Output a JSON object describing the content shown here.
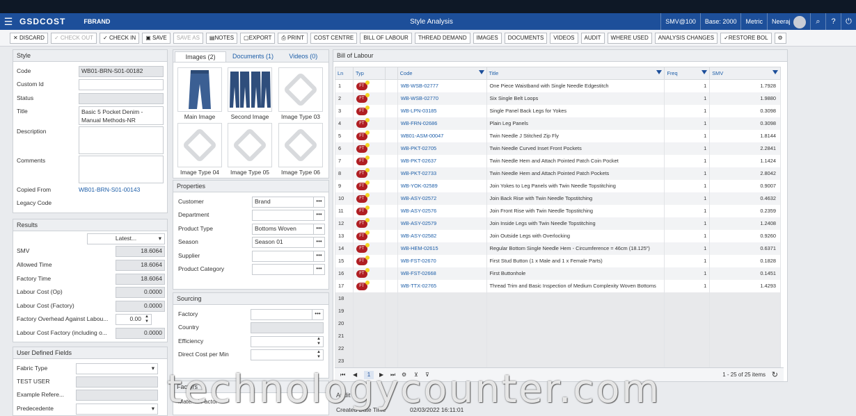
{
  "app": {
    "logo": "GSDCOST",
    "brand": "FBRAND",
    "title": "Style Analysis",
    "smv_mode": "SMV@100",
    "base": "Base: 2000",
    "units": "Metric",
    "user": "Neeraj"
  },
  "toolbar": [
    "DISCARD",
    "CHECK OUT",
    "CHECK IN",
    "SAVE",
    "SAVE AS",
    "NOTES",
    "EXPORT",
    "PRINT",
    "COST CENTRE",
    "BILL OF LABOUR",
    "THREAD DEMAND",
    "IMAGES",
    "DOCUMENTS",
    "VIDEOS",
    "AUDIT",
    "WHERE USED",
    "ANALYSIS CHANGES",
    "RESTORE BOL"
  ],
  "style": {
    "header": "Style",
    "fields": [
      {
        "label": "Code",
        "value": "WB01-BRN-S01-00182"
      },
      {
        "label": "Custom Id",
        "value": ""
      },
      {
        "label": "Status",
        "value": ""
      },
      {
        "label": "Title",
        "value": "Basic 5 Pocket Denim - Manual Methods-NR"
      },
      {
        "label": "Description",
        "value": ""
      },
      {
        "label": "Comments",
        "value": ""
      },
      {
        "label": "Copied From",
        "value": "WB01-BRN-S01-00143"
      },
      {
        "label": "Legacy Code",
        "value": ""
      }
    ]
  },
  "results": {
    "header": "Results",
    "selector": "Latest...",
    "fields": [
      {
        "label": "SMV",
        "value": "18.6064"
      },
      {
        "label": "Allowed Time",
        "value": "18.6064"
      },
      {
        "label": "Factory Time",
        "value": "18.6064"
      },
      {
        "label": "Labour Cost (Op)",
        "value": "0.0000"
      },
      {
        "label": "Labour Cost (Factory)",
        "value": "0.0000"
      },
      {
        "label": "Factory Overhead Against Labou...",
        "value": "0.00"
      },
      {
        "label": "Labour Cost Factory (including o...",
        "value": "0.0000"
      }
    ]
  },
  "udf": {
    "header": "User Defined Fields",
    "fields": [
      "Fabric Type",
      "TEST USER",
      "Example Refere...",
      "Predecedente"
    ]
  },
  "media": {
    "tabs": [
      "Images (2)",
      "Documents (1)",
      "Videos (0)"
    ],
    "images": [
      "Main Image",
      "Second Image",
      "Image Type 03",
      "Image Type 04",
      "Image Type 05",
      "Image Type 06"
    ]
  },
  "properties": {
    "header": "Properties",
    "fields": [
      {
        "label": "Customer",
        "value": "Brand"
      },
      {
        "label": "Department",
        "value": ""
      },
      {
        "label": "Product Type",
        "value": "Bottoms Woven"
      },
      {
        "label": "Season",
        "value": "Season 01"
      },
      {
        "label": "Supplier",
        "value": ""
      },
      {
        "label": "Product Category",
        "value": ""
      }
    ]
  },
  "sourcing": {
    "header": "Sourcing",
    "fields": [
      "Factory",
      "Country",
      "Efficiency",
      "Direct Cost per Min"
    ]
  },
  "factors": {
    "header": "Factors",
    "sub": "Material Factor"
  },
  "audit": {
    "header": "Audit",
    "created_label": "Created Date Time",
    "created": "02/03/2022 16:11:01"
  },
  "bol": {
    "header": "Bill of Labour",
    "columns": [
      "Ln",
      "Typ",
      "Code",
      "Title",
      "Freq",
      "SMV"
    ],
    "type_badge": "FT",
    "rows": [
      [
        "1",
        "WB-WSB-02777",
        "One Piece Waistband with Single Needle Edgestitch",
        "1",
        "1.7928"
      ],
      [
        "2",
        "WB-WSB-02770",
        "Six Single Belt Loops",
        "1",
        "1.9880"
      ],
      [
        "3",
        "WB-LPN-03185",
        "Single Panel Back Legs for Yokes",
        "1",
        "0.3098"
      ],
      [
        "4",
        "WB-FRN-02686",
        "Plain Leg Panels",
        "1",
        "0.3098"
      ],
      [
        "5",
        "WB01-ASM-00047",
        "Twin Needle J Stitched Zip Fly",
        "1",
        "1.8144"
      ],
      [
        "6",
        "WB-PKT-02705",
        "Twin Needle Curved Inset Front Pockets",
        "1",
        "2.2841"
      ],
      [
        "7",
        "WB-PKT-02637",
        "Twin Needle Hem and Attach Pointed Patch Coin Pocket",
        "1",
        "1.1424"
      ],
      [
        "8",
        "WB-PKT-02733",
        "Twin Needle Hem and Attach Pointed Patch Pockets",
        "1",
        "2.8042"
      ],
      [
        "9",
        "WB-YOK-02589",
        "Join Yokes to Leg Panels with Twin Needle Topstitching",
        "1",
        "0.9007"
      ],
      [
        "10",
        "WB-ASY-02572",
        "Join Back Rise with Twin Needle Topstitching",
        "1",
        "0.4632"
      ],
      [
        "11",
        "WB-ASY-02576",
        "Join Front Rise with Twin Needle Topstitching",
        "1",
        "0.2359"
      ],
      [
        "12",
        "WB-ASY-02579",
        "Join Inside Legs with Twin Needle Topstitching",
        "1",
        "1.2408"
      ],
      [
        "13",
        "WB-ASY-02582",
        "Join Outside Legs with Overlocking",
        "1",
        "0.9260"
      ],
      [
        "14",
        "WB-HEM-02615",
        "Regular Bottom Single Needle Hem - Circumference = 46cm (18.125\")",
        "1",
        "0.6371"
      ],
      [
        "15",
        "WB-FST-02670",
        "First Stud Button (1 x Male and 1 x Female Parts)",
        "1",
        "0.1828"
      ],
      [
        "16",
        "WB-FST-02668",
        "First Buttonhole",
        "1",
        "0.1451"
      ],
      [
        "17",
        "WB-TTX-02765",
        "Thread Trim and Basic Inspection of Medium Complexity Woven Bottoms",
        "1",
        "1.4293"
      ]
    ],
    "empty_rows": [
      "18",
      "19",
      "20",
      "21",
      "22",
      "23"
    ],
    "page": "1",
    "pager_info": "1 - 25 of 25 items"
  },
  "watermark": "technologycounter.com"
}
